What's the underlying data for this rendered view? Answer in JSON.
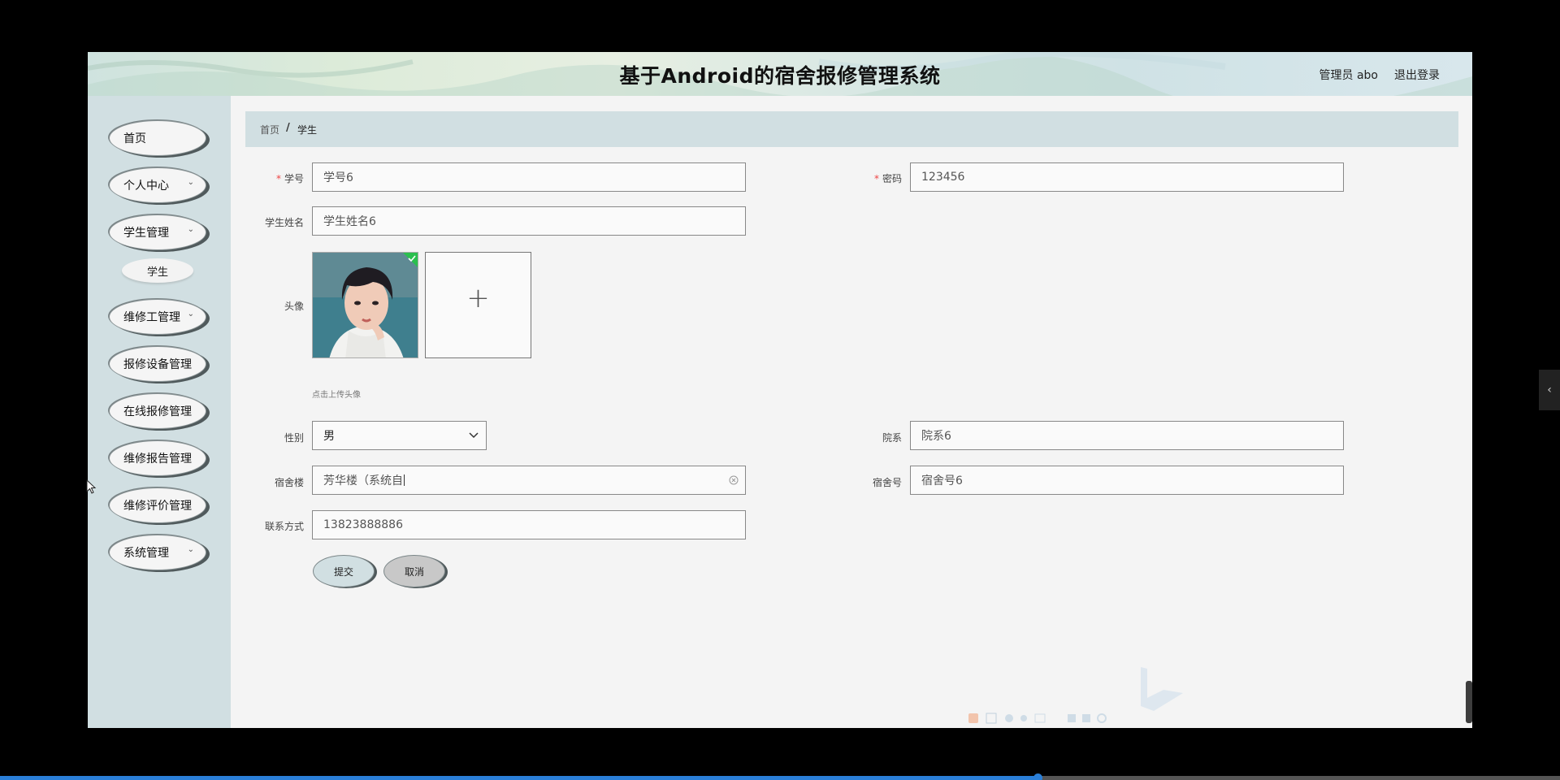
{
  "header": {
    "title": "基于Android的宿舍报修管理系统",
    "user": "管理员 abo",
    "logout": "退出登录"
  },
  "sidebar": {
    "items": [
      {
        "label": "首页",
        "has_submenu": false
      },
      {
        "label": "个人中心",
        "has_submenu": true
      },
      {
        "label": "学生管理",
        "has_submenu": true
      },
      {
        "label": "维修工管理",
        "has_submenu": true
      },
      {
        "label": "报修设备管理",
        "has_submenu": false
      },
      {
        "label": "在线报修管理",
        "has_submenu": false
      },
      {
        "label": "维修报告管理",
        "has_submenu": false
      },
      {
        "label": "维修评价管理",
        "has_submenu": false
      },
      {
        "label": "系统管理",
        "has_submenu": true
      }
    ],
    "sub_item": "学生"
  },
  "breadcrumb": {
    "home": "首页",
    "separator": "/",
    "current": "学生"
  },
  "form": {
    "student_no": {
      "label": "学号",
      "value": "学号6",
      "required": true
    },
    "password": {
      "label": "密码",
      "value": "123456",
      "required": true
    },
    "student_name": {
      "label": "学生姓名",
      "value": "学生姓名6"
    },
    "avatar": {
      "label": "头像",
      "hint": "点击上传头像",
      "add_symbol": "+"
    },
    "gender": {
      "label": "性别",
      "value": "男"
    },
    "department": {
      "label": "院系",
      "value": "院系6"
    },
    "building": {
      "label": "宿舍楼",
      "value": "芳华楼（系统自"
    },
    "room_no": {
      "label": "宿舍号",
      "value": "宿舍号6"
    },
    "contact": {
      "label": "联系方式",
      "value": "13823888886"
    },
    "submit": "提交",
    "cancel": "取消"
  },
  "icons": {
    "chevron": "chevron-down-icon",
    "clear": "clear-icon",
    "side_tab": "chevron-left-icon"
  },
  "colors": {
    "sidebar_bg": "#d1dfe2",
    "breadcrumb_bg": "#d1dfe2",
    "content_bg": "#f4f4f4",
    "required_mark": "#e44444",
    "submit_bg": "#d1dfe2",
    "cancel_bg": "#c8c8c8",
    "upload_check": "#2bbf4f"
  },
  "video": {
    "progress": 0.665
  }
}
